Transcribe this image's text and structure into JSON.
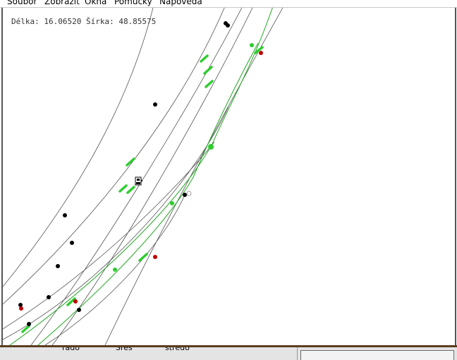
{
  "menu": {
    "items": [
      "Soubor",
      "Zobrazit",
      "Okna",
      "Pomůcky",
      "Nápověda"
    ]
  },
  "map": {
    "coord_readout": "Délka: 16.06520 Šírka: 48.85575",
    "colors": {
      "road_line": "#555555",
      "route_line": "#22a822",
      "segment_marker": "#2ecc2e",
      "node": "#000000",
      "red_node": "#c00000"
    },
    "icons": [
      "fuel-station-icon"
    ]
  },
  "statusbar": {
    "field1": "rado",
    "field2": "Sres",
    "field3": "stredo"
  }
}
